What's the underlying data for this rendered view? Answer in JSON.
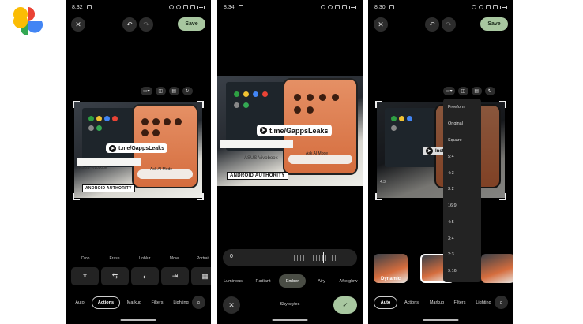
{
  "logo": {
    "name": "Google Photos"
  },
  "phones": [
    {
      "time": "8:32",
      "save_label": "Save",
      "photo_text": {
        "tme": "t.me/GappsLeaks",
        "brand": "ANDROID AUTHORITY",
        "laptop": "ASUS Vivobook",
        "ask": "Ask AI Mode"
      },
      "tools": [
        "Crop",
        "Erase",
        "Unblur",
        "Move",
        "Portrait"
      ],
      "tabs": [
        "Auto",
        "Actions",
        "Markup",
        "Filters",
        "Lighting"
      ],
      "active_tab": "Actions"
    },
    {
      "time": "8:34",
      "photo_text": {
        "tme": "t.me/GappsLeaks",
        "brand": "ANDROID AUTHORITY",
        "laptop": "ASUS Vivobook",
        "ask": "Ask AI Mode"
      },
      "slider_value": "0",
      "sky_styles": [
        "Luminous",
        "Radiant",
        "Ember",
        "Airy",
        "Afterglow"
      ],
      "active_style": "Ember",
      "footer_label": "Sky styles"
    },
    {
      "time": "8:30",
      "save_label": "Save",
      "photo_text": {
        "install": "Install",
        "aspect": "4:3"
      },
      "aspect_options": [
        "Freeform",
        "Original",
        "Square",
        "5:4",
        "4:3",
        "3:2",
        "16:9",
        "4:5",
        "3:4",
        "2:3",
        "9:16"
      ],
      "thumb_label": "Dynamic",
      "tabs": [
        "Auto",
        "Actions",
        "Markup",
        "Filters",
        "Lighting"
      ],
      "active_tab": "Auto"
    }
  ],
  "colors": {
    "accent_green": "#a8c7a0",
    "panel": "#232323",
    "background": "#000000"
  }
}
